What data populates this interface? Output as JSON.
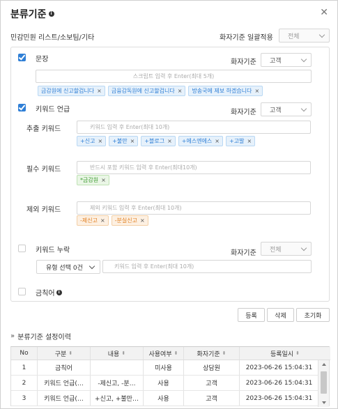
{
  "header": {
    "title": "분류기준",
    "close_icon": "close-icon"
  },
  "subtitle": "민감민원 리스트/소보팀/기타",
  "global": {
    "label": "화자기준 일괄적용",
    "value": "전체"
  },
  "speaker_label": "화자기준",
  "sentence": {
    "label": "문장",
    "speaker_value": "고객",
    "placeholder": "스크립트 입력 후 Enter(최대 5개)",
    "tags": [
      "금감원에 신고할겁니다",
      "금융감독원에 신고할겁니다",
      "방송국에 제보 하겠습니다"
    ]
  },
  "keyword_mention": {
    "label": "키워드 언급",
    "speaker_value": "고객",
    "extract": {
      "label": "추출 키워드",
      "placeholder": "키워드 입력 후 Enter(최대 10개)",
      "tags": [
        "+신고",
        "+불만",
        "+블로그",
        "+에스엔에스",
        "+고발"
      ]
    },
    "required": {
      "label": "필수 키워드",
      "placeholder": "반드시 포함 키워드 입력 후 Enter(최대10개)",
      "tags": [
        "*금감원"
      ]
    },
    "exclude": {
      "label": "제외 키워드",
      "placeholder": "제외 키워드 입력 후 Enter(최대 10개)",
      "tags": [
        "-제신고",
        "-분실신고"
      ]
    }
  },
  "keyword_omission": {
    "label": "키워드 누락",
    "speaker_value": "전체",
    "type_select": "유형 선택 0건",
    "placeholder": "키워드 입력 후 Enter(최대 10개)"
  },
  "banned_words": {
    "label": "금칙어"
  },
  "buttons": {
    "register": "등록",
    "delete": "삭제",
    "reset": "초기화"
  },
  "history": {
    "title": "분류기준 설정이력",
    "columns": [
      "No",
      "구분",
      "내용",
      "사용여부",
      "화자기준",
      "등록일시"
    ],
    "rows": [
      [
        "1",
        "금칙어",
        "",
        "미사용",
        "상담원",
        "2023-06-26 15:04:31"
      ],
      [
        "2",
        "키워드 언급(…",
        "-제신고, -분…",
        "사용",
        "고객",
        "2023-06-26 15:04:31"
      ],
      [
        "3",
        "키워드 언급(…",
        "+신고, +불만…",
        "사용",
        "고객",
        "2023-06-26 15:04:31"
      ]
    ]
  },
  "colors": {
    "accent": "#2f7fd6",
    "tag_blue": "#e6f1fb",
    "tag_green": "#eaf6e6",
    "tag_orange": "#fdf0e2"
  }
}
